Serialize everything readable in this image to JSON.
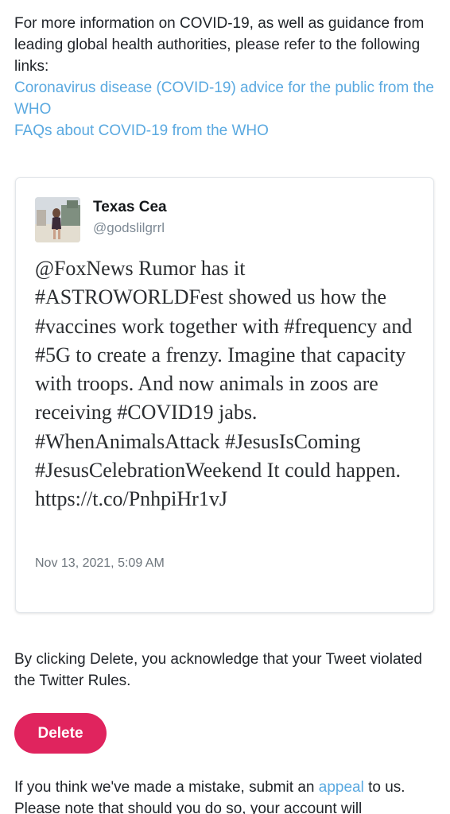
{
  "intro": {
    "text": "For more information on COVID-19, as well as guidance from leading global health authorities, please refer to the following links:",
    "links": [
      "Coronavirus disease (COVID-19) advice for the public from the WHO",
      "FAQs about COVID-19 from the WHO"
    ]
  },
  "tweet": {
    "author_name": "Texas Cea",
    "author_handle": "@godslilgrrl",
    "text": "@FoxNews Rumor has it #ASTROWORLDFest showed us how the #vaccines work together with #frequency and #5G to create a frenzy. Imagine that capacity with troops. And now animals in zoos are receiving #COVID19 jabs. #WhenAnimalsAttack #JesusIsComing #JesusCelebrationWeekend It could happen. https://t.co/PnhpiHr1vJ",
    "timestamp": "Nov 13, 2021, 5:09 AM"
  },
  "acknowledgement": "By clicking Delete, you acknowledge that your Tweet violated the Twitter Rules.",
  "delete_label": "Delete",
  "appeal": {
    "before": "If you think we've made a mistake, submit an ",
    "link": "appeal",
    "after": " to us. Please note that should you do so, your account will"
  },
  "colors": {
    "link": "#5aa9e0",
    "delete_button": "#e0245e",
    "handle_gray": "#7e8a95"
  }
}
